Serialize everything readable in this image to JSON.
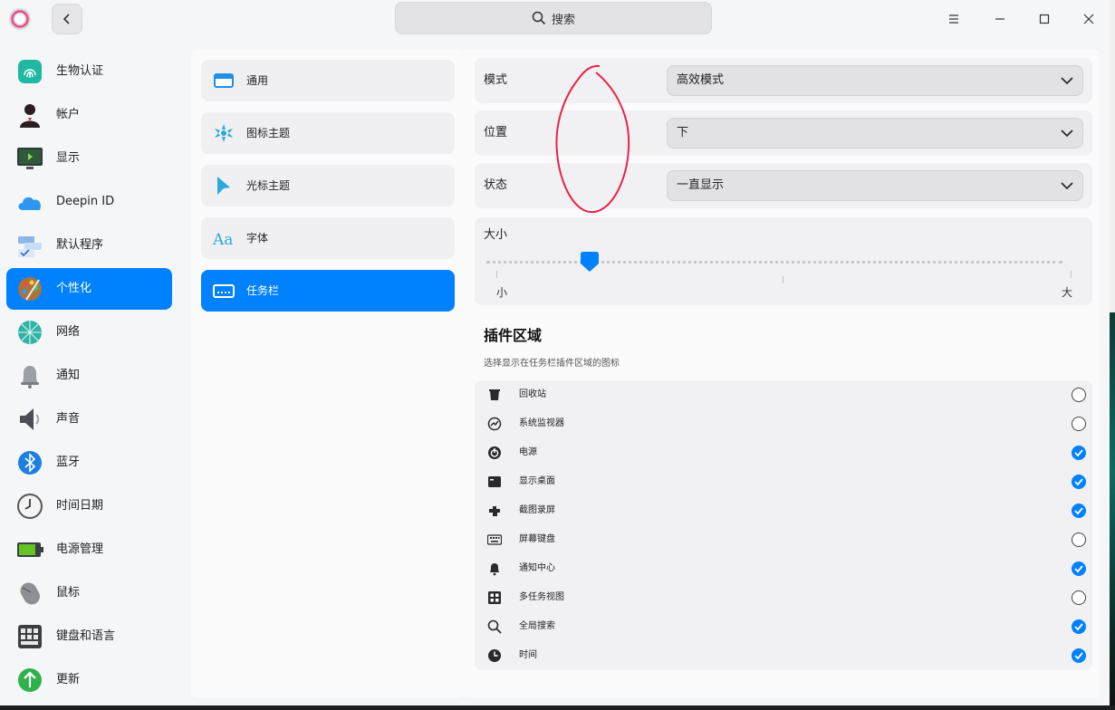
{
  "search": {
    "label": "搜索"
  },
  "sidebar": {
    "items": [
      {
        "label": "生物认证",
        "icon": "fingerprint-icon"
      },
      {
        "label": "帐户",
        "icon": "account-icon"
      },
      {
        "label": "显示",
        "icon": "display-icon"
      },
      {
        "label": "Deepin ID",
        "icon": "cloud-icon"
      },
      {
        "label": "默认程序",
        "icon": "default-apps-icon"
      },
      {
        "label": "个性化",
        "icon": "personalization-icon",
        "active": true
      },
      {
        "label": "网络",
        "icon": "network-icon"
      },
      {
        "label": "通知",
        "icon": "bell-icon"
      },
      {
        "label": "声音",
        "icon": "speaker-icon"
      },
      {
        "label": "蓝牙",
        "icon": "bluetooth-icon"
      },
      {
        "label": "时间日期",
        "icon": "clock-icon"
      },
      {
        "label": "电源管理",
        "icon": "battery-icon"
      },
      {
        "label": "鼠标",
        "icon": "mouse-icon"
      },
      {
        "label": "键盘和语言",
        "icon": "keyboard-icon"
      },
      {
        "label": "更新",
        "icon": "update-icon"
      }
    ]
  },
  "subnav": {
    "items": [
      {
        "label": "通用",
        "icon": "window-icon"
      },
      {
        "label": "图标主题",
        "icon": "icon-theme-icon"
      },
      {
        "label": "光标主题",
        "icon": "cursor-theme-icon"
      },
      {
        "label": "字体",
        "icon": "font-icon"
      },
      {
        "label": "任务栏",
        "icon": "taskbar-icon",
        "active": true
      }
    ]
  },
  "taskbar": {
    "mode_label": "模式",
    "mode_value": "高效模式",
    "position_label": "位置",
    "position_value": "下",
    "state_label": "状态",
    "state_value": "一直显示",
    "size_label": "大小",
    "size_min": "小",
    "size_max": "大",
    "size_level": 0.18
  },
  "plugins": {
    "title": "插件区域",
    "description": "选择显示在任务栏插件区域的图标",
    "items": [
      {
        "label": "回收站",
        "icon": "trash-icon",
        "checked": false
      },
      {
        "label": "系统监视器",
        "icon": "system-monitor-icon",
        "checked": false
      },
      {
        "label": "电源",
        "icon": "power-icon",
        "checked": true
      },
      {
        "label": "显示桌面",
        "icon": "show-desktop-icon",
        "checked": true
      },
      {
        "label": "截图录屏",
        "icon": "screenshot-icon",
        "checked": true
      },
      {
        "label": "屏幕键盘",
        "icon": "onscreen-keyboard-icon",
        "checked": false
      },
      {
        "label": "通知中心",
        "icon": "notification-center-icon",
        "checked": true
      },
      {
        "label": "多任务视图",
        "icon": "multitask-view-icon",
        "checked": false
      },
      {
        "label": "全局搜索",
        "icon": "global-search-icon",
        "checked": true
      },
      {
        "label": "时间",
        "icon": "time-icon",
        "checked": true
      }
    ]
  },
  "colors": {
    "accent": "#0081ff",
    "annotation": "#e8234a"
  }
}
